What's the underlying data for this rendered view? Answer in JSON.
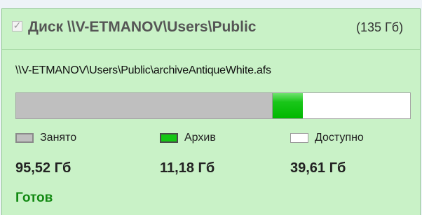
{
  "disk": {
    "title": "Диск \\\\V-ETMANOV\\Users\\Public",
    "capacity": "(135 Гб)",
    "checkbox_glyph": "✓",
    "checked": true,
    "path": "\\\\V-ETMANOV\\Users\\Public\\archiveAntiqueWhite.afs"
  },
  "usage": {
    "used_fraction": 0.652,
    "archive_fraction": 0.076
  },
  "legend": {
    "used_label": "Занято",
    "archive_label": "Архив",
    "free_label": "Доступно"
  },
  "values": {
    "used": "95,52 Гб",
    "archive": "11,18 Гб",
    "free": "39,61 Гб"
  },
  "status": "Готов",
  "colors": {
    "panel_bg": "#c9f2c7",
    "used_fill": "#bfbfbf",
    "archive_fill": "#13c713",
    "free_fill": "#ffffff",
    "status_text": "#138a13"
  }
}
